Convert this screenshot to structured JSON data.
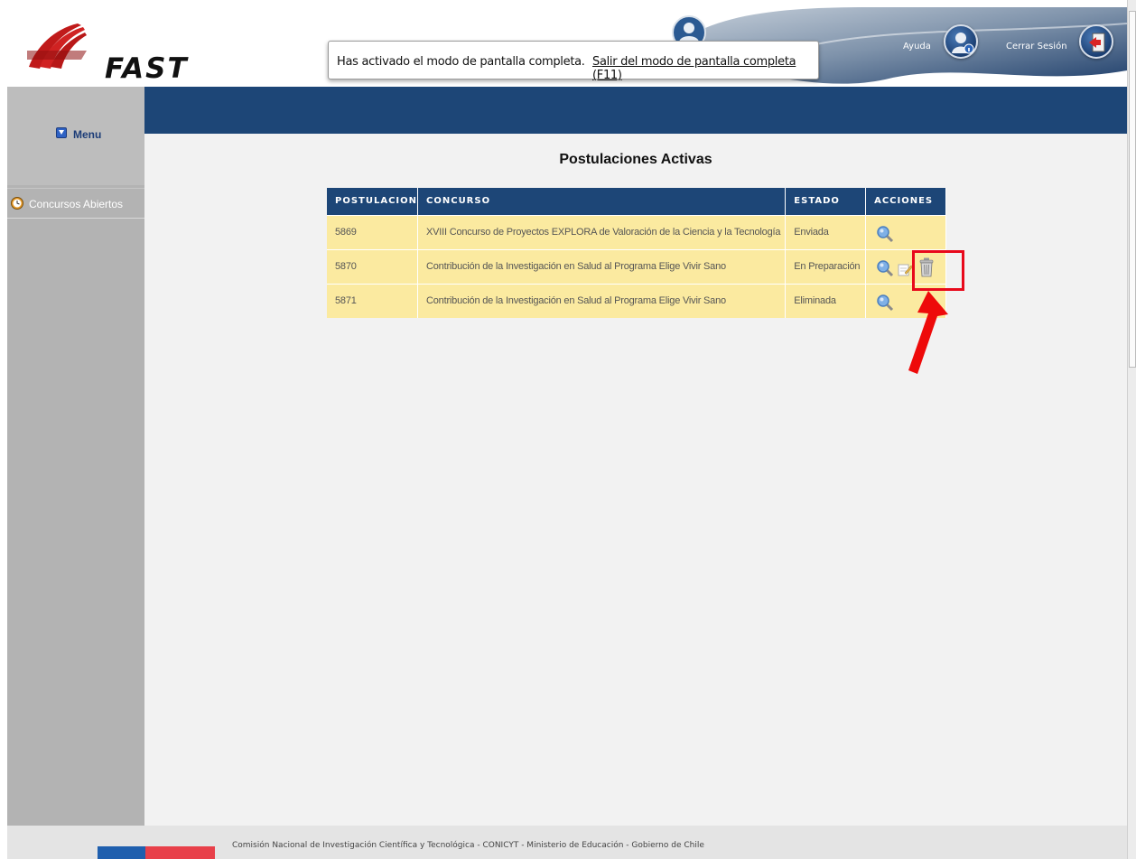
{
  "header": {
    "logo_text": "FAST",
    "help_label": "Ayuda",
    "logout_label": "Cerrar Sesión"
  },
  "fullscreen_notice": {
    "message": "Has activado el modo de pantalla completa.",
    "exit_link": "Salir del modo de pantalla completa (F11)"
  },
  "sidebar": {
    "menu_label": "Menu",
    "items": [
      {
        "label": "Concursos Abiertos",
        "icon": "clock-icon"
      }
    ]
  },
  "main": {
    "title": "Postulaciones Activas",
    "columns": [
      "POSTULACION",
      "CONCURSO",
      "ESTADO",
      "ACCIONES"
    ],
    "rows": [
      {
        "postulacion": "5869",
        "concurso": "XVIII Concurso de Proyectos EXPLORA de Valoración de la Ciencia y la Tecnología",
        "estado": "Enviada",
        "actions": [
          "view"
        ]
      },
      {
        "postulacion": "5870",
        "concurso": "Contribución de la Investigación en Salud al Programa Elige Vivir Sano",
        "estado": "En Preparación",
        "actions": [
          "view",
          "edit",
          "delete"
        ]
      },
      {
        "postulacion": "5871",
        "concurso": "Contribución de la Investigación en Salud al Programa Elige Vivir Sano",
        "estado": "Eliminada",
        "actions": [
          "view"
        ]
      }
    ]
  },
  "footer": {
    "text": "Comisión Nacional de Investigación Científica y Tecnológica - CONICYT - Ministerio de Educación - Gobierno de Chile"
  },
  "colors": {
    "primary_blue": "#1d4677",
    "row_yellow": "#fbeaa0",
    "sidebar_gray": "#b3b3b3",
    "highlight_red": "#e8091b"
  }
}
